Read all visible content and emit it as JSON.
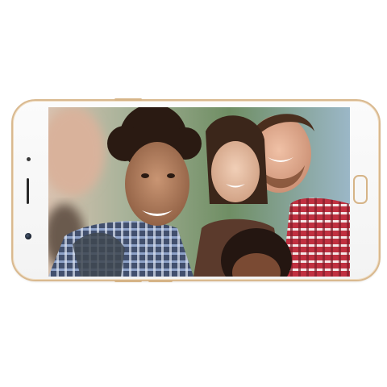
{
  "scene": {
    "device": "smartphone-landscape",
    "frame_color": "#d9b98f",
    "body_color": "#f5f5f5",
    "screen_content": "group-selfie-photo"
  }
}
